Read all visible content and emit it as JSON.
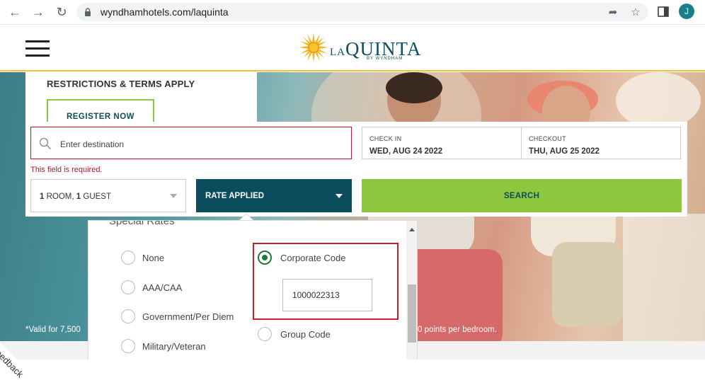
{
  "browser": {
    "url": "wyndhamhotels.com/laquinta",
    "avatar_initial": "J"
  },
  "header": {
    "logo_small": "LA",
    "logo_large": "QUINTA",
    "logo_sub": "BY WYNDHAM",
    "accent_color": "#f2c233"
  },
  "promo": {
    "title": "RESTRICTIONS & TERMS APPLY",
    "register_label": "REGISTER NOW"
  },
  "booking": {
    "destination_placeholder": "Enter destination",
    "error": "This field is required.",
    "checkin_label": "CHECK IN",
    "checkin_value": "WED, AUG 24 2022",
    "checkout_label": "CHECKOUT",
    "checkout_value": "THU, AUG 25 2022",
    "rooms_strong": "1",
    "rooms_text": " ROOM, ",
    "guests_strong": "1",
    "guests_text": " GUEST",
    "rate_label": "RATE APPLIED",
    "search_label": "SEARCH"
  },
  "disclaimer": {
    "left": "*Valid for 7,500",
    "right": "0 points per bedroom."
  },
  "feedback_label": "Feedback",
  "special_rates": {
    "heading": "Special Rates",
    "options": [
      {
        "label": "None",
        "checked": false
      },
      {
        "label": "AAA/CAA",
        "checked": false
      },
      {
        "label": "Government/Per Diem",
        "checked": false
      },
      {
        "label": "Military/Veteran",
        "checked": false
      },
      {
        "label": "Corporate Code",
        "checked": true
      },
      {
        "label": "Group Code",
        "checked": false
      }
    ],
    "corporate_code_value": "1000022313"
  }
}
